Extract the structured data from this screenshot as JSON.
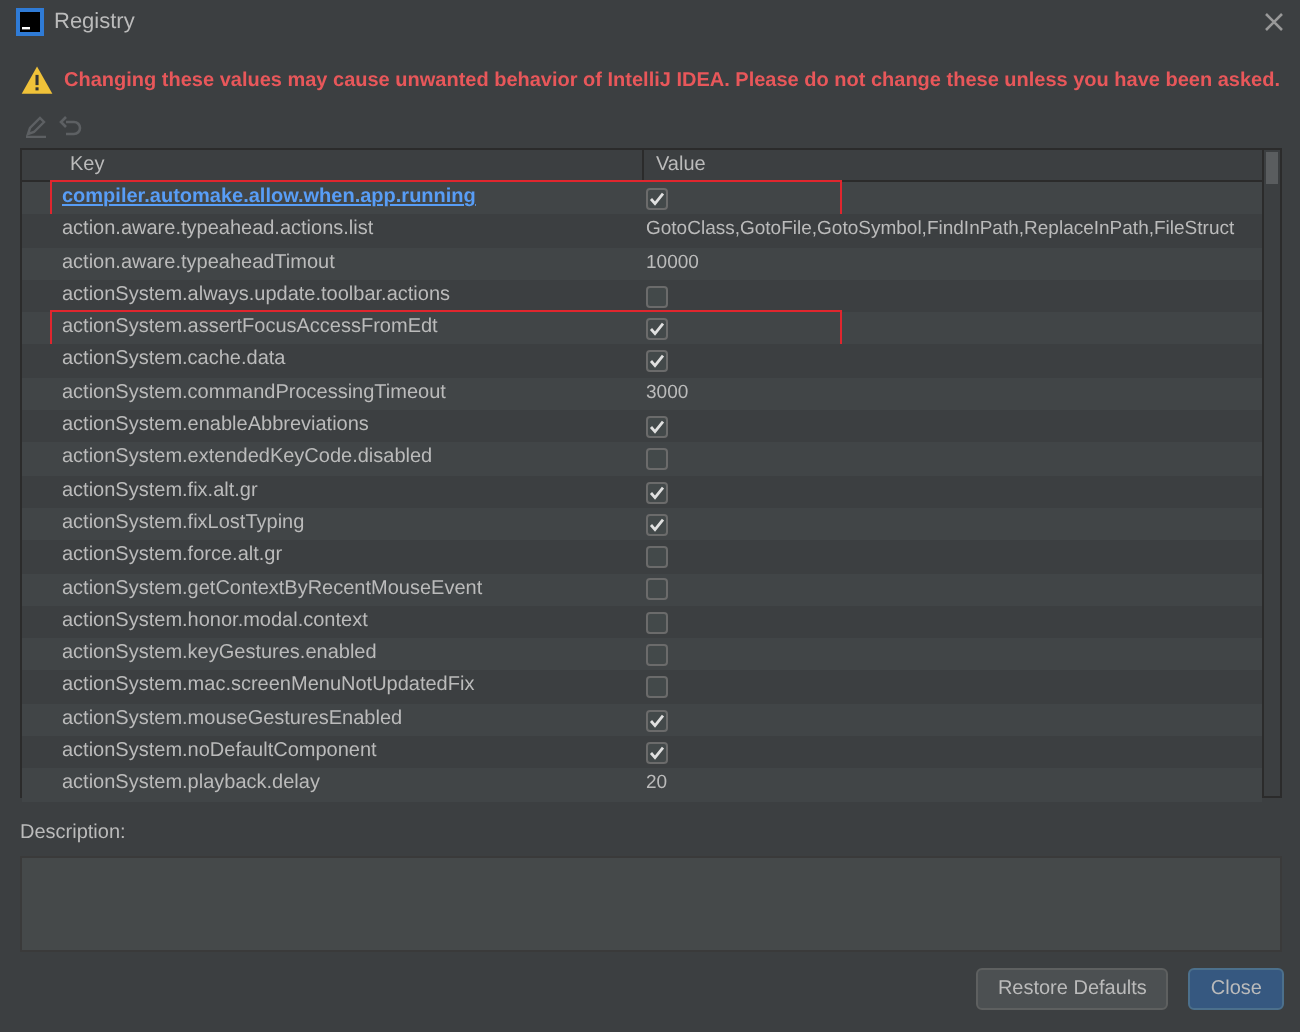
{
  "window": {
    "title": "Registry"
  },
  "warning": "Changing these values may cause unwanted behavior of IntelliJ IDEA. Please do not change these unless you have been asked.",
  "toolbar": [
    {
      "kind": "edit",
      "disabled": true
    },
    {
      "kind": "revert",
      "disabled": true
    }
  ],
  "table": {
    "columns": [
      "Key",
      "Value"
    ],
    "rows": [
      {
        "key": "compiler.automake.allow.when.app.running",
        "kind": "checkbox",
        "checked": true,
        "selected": true,
        "highlighted": true
      },
      {
        "key": "action.aware.typeahead.actions.list",
        "kind": "text",
        "value": "GotoClass,GotoFile,GotoSymbol,FindInPath,ReplaceInPath,FileStruct",
        "selected": false,
        "highlighted": false
      },
      {
        "key": "action.aware.typeaheadTimout",
        "kind": "text",
        "value": "10000",
        "selected": false,
        "highlighted": false
      },
      {
        "key": "actionSystem.always.update.toolbar.actions",
        "kind": "checkbox",
        "checked": false,
        "selected": false,
        "highlighted": false
      },
      {
        "key": "actionSystem.assertFocusAccessFromEdt",
        "kind": "checkbox",
        "checked": true,
        "selected": false,
        "highlighted": true
      },
      {
        "key": "actionSystem.cache.data",
        "kind": "checkbox",
        "checked": true,
        "selected": false,
        "highlighted": false
      },
      {
        "key": "actionSystem.commandProcessingTimeout",
        "kind": "text",
        "value": "3000",
        "selected": false,
        "highlighted": false
      },
      {
        "key": "actionSystem.enableAbbreviations",
        "kind": "checkbox",
        "checked": true,
        "selected": false,
        "highlighted": false
      },
      {
        "key": "actionSystem.extendedKeyCode.disabled",
        "kind": "checkbox",
        "checked": false,
        "selected": false,
        "highlighted": false
      },
      {
        "key": "actionSystem.fix.alt.gr",
        "kind": "checkbox",
        "checked": true,
        "selected": false,
        "highlighted": false
      },
      {
        "key": "actionSystem.fixLostTyping",
        "kind": "checkbox",
        "checked": true,
        "selected": false,
        "highlighted": false
      },
      {
        "key": "actionSystem.force.alt.gr",
        "kind": "checkbox",
        "checked": false,
        "selected": false,
        "highlighted": false
      },
      {
        "key": "actionSystem.getContextByRecentMouseEvent",
        "kind": "checkbox",
        "checked": false,
        "selected": false,
        "highlighted": false
      },
      {
        "key": "actionSystem.honor.modal.context",
        "kind": "checkbox",
        "checked": false,
        "selected": false,
        "highlighted": false
      },
      {
        "key": "actionSystem.keyGestures.enabled",
        "kind": "checkbox",
        "checked": false,
        "selected": false,
        "highlighted": false
      },
      {
        "key": "actionSystem.mac.screenMenuNotUpdatedFix",
        "kind": "checkbox",
        "checked": false,
        "selected": false,
        "highlighted": false
      },
      {
        "key": "actionSystem.mouseGesturesEnabled",
        "kind": "checkbox",
        "checked": true,
        "selected": false,
        "highlighted": false
      },
      {
        "key": "actionSystem.noDefaultComponent",
        "kind": "checkbox",
        "checked": true,
        "selected": false,
        "highlighted": false
      },
      {
        "key": "actionSystem.playback.delay",
        "kind": "text",
        "value": "20",
        "selected": false,
        "highlighted": false
      }
    ]
  },
  "description": {
    "label": "Description:"
  },
  "buttons": [
    {
      "label": "Restore Defaults",
      "primary": false
    },
    {
      "label": "Close",
      "primary": true
    }
  ]
}
